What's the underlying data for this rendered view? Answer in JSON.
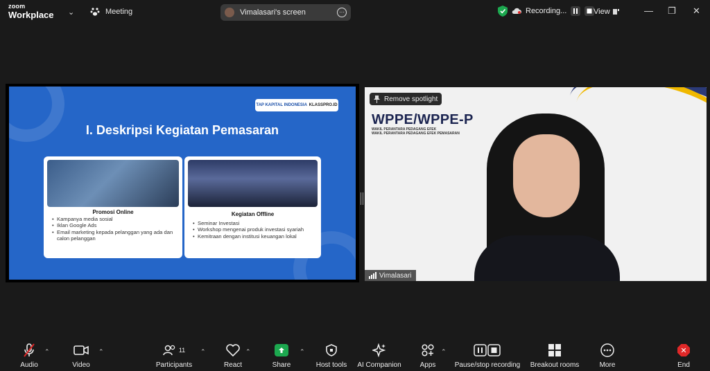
{
  "app": {
    "brand_top": "zoom",
    "brand_bottom": "Workplace"
  },
  "topbar": {
    "meeting_label": "Meeting",
    "screen_share_label": "Vimalasari's screen",
    "recording_label": "Recording...",
    "view_label": "View"
  },
  "slide": {
    "logo_left": "TAP KAPITAL INDONESIA",
    "logo_right": "KLASSPRO.ID",
    "title": "I. Deskripsi Kegiatan Pemasaran",
    "cards": [
      {
        "title": "Promosi Online",
        "items": [
          "Kampanya media sosial",
          "Iklan Google Ads",
          "Email marketing kepada pelanggan yang ada dan calon pelanggan"
        ]
      },
      {
        "title": "Kegiatan Offline",
        "items": [
          "Seminar Investasi",
          "Workshop mengenai produk investasi syariah",
          "Kemitraan dengan institusi keuangan lokal"
        ]
      }
    ]
  },
  "video": {
    "spotlight_button": "Remove spotlight",
    "bg_title": "WPPE/WPPE-P",
    "bg_sub1": "WAKIL PERANTARA PEDAGANG EFEK",
    "bg_sub2": "WAKIL PERANTARA PEDAGANG EFEK PEMASARAN",
    "participant_name": "Vimalasari"
  },
  "toolbar": {
    "audio": "Audio",
    "video": "Video",
    "participants": "Participants",
    "participants_count": "11",
    "react": "React",
    "share": "Share",
    "host_tools": "Host tools",
    "ai_companion": "AI Companion",
    "apps": "Apps",
    "pause_stop": "Pause/stop recording",
    "breakout": "Breakout rooms",
    "more": "More",
    "end": "End"
  },
  "colors": {
    "share_green": "#1ca84f",
    "end_red": "#e02828",
    "slide_blue": "#2566c8",
    "shield_green": "#1ca84f"
  }
}
